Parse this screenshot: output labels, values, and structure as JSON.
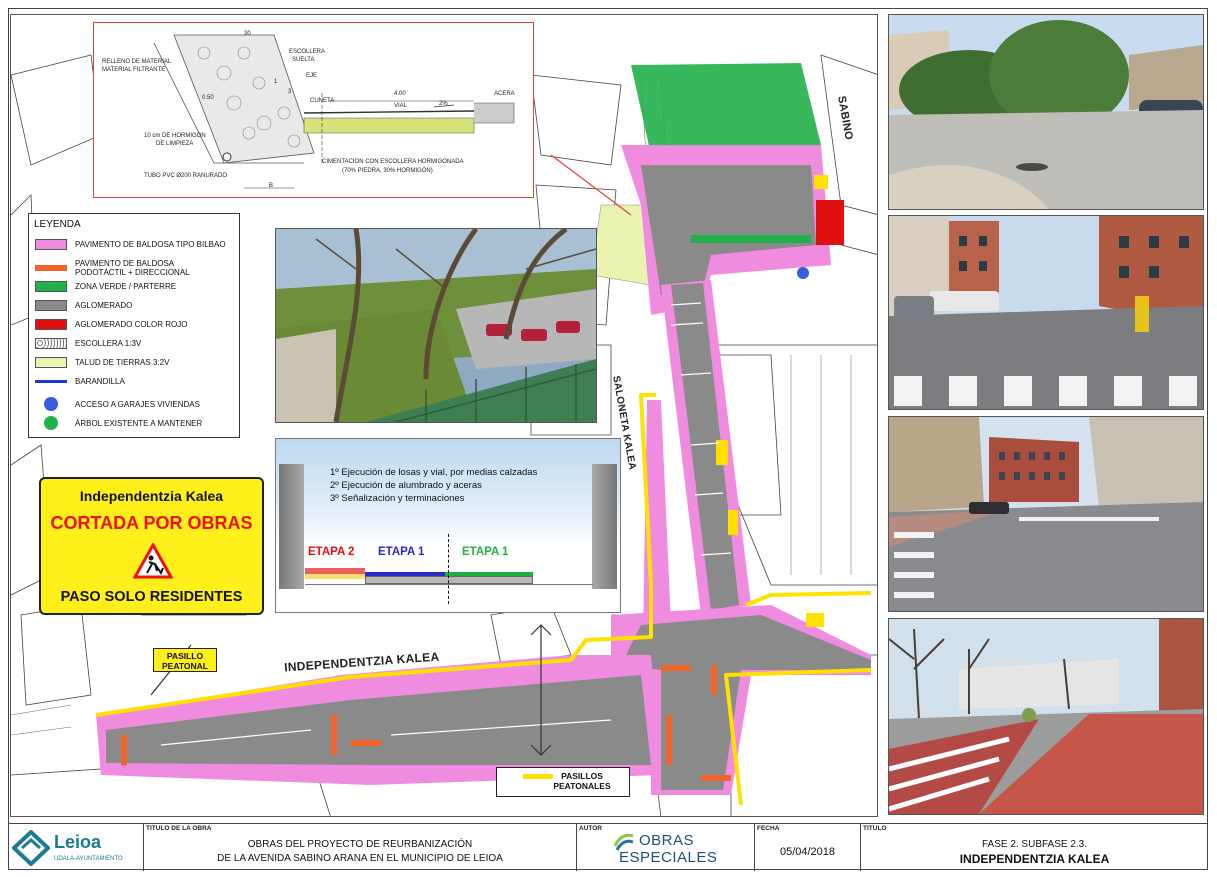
{
  "section": {
    "labels": {
      "relleno": "RELLENO DE MATERIAL",
      "filtrante": "MATERIAL FILTRANTE",
      "escollera": "ESCOLLERA",
      "suelta": "SUELTA",
      "eje": "EJE",
      "cuneta": "CUNETA",
      "vial_dim": "4.00",
      "vial": "VIAL",
      "pendiente": "2%",
      "acera": "ACERA",
      "hormigon": "10 cm DE HORMIGON",
      "limpieza": "DE LIMPIEZA",
      "tubo": "TUBO PVC Ø200 RANURADO",
      "cimentacion": "CIMENTACION CON ESCOLLERA HORMIGONADA",
      "proporcion": "(70% PIEDRA, 30% HORMIGÓN)",
      "talud": "0.50",
      "ratio1": "1",
      "ratio3": "3",
      "b": "B",
      "dim": "30"
    }
  },
  "legend": {
    "title": "LEYENDA",
    "items": [
      {
        "label": "PAVIMENTO DE BALDOSA TIPO BILBAO",
        "color": "#f08ce0"
      },
      {
        "label": "PAVIMENTO DE BALDOSA",
        "label2": "PODOTÁCTIL + DIRECCIONAL",
        "color": "#f0642a"
      },
      {
        "label": "ZONA VERDE / PARTERRE",
        "color": "#22b04a"
      },
      {
        "label": "AGLOMERADO",
        "color": "#8a8a8a"
      },
      {
        "label": "AGLOMERADO COLOR ROJO",
        "color": "#e01010"
      },
      {
        "label": "ESCOLLERA 1:3V",
        "color": "#ffffff"
      },
      {
        "label": "TALUD DE TIERRAS 3:2V",
        "color": "#eaf3b0"
      },
      {
        "label": "BARANDILLA",
        "color": "#1a3ad0"
      },
      {
        "label": "ACCESO A GARAJES VIVIENDAS",
        "color": "#3a5ae0"
      },
      {
        "label": "ÁRBOL EXISTENTE A MANTENER",
        "color": "#22b04a"
      }
    ]
  },
  "stages": {
    "steps": [
      "1º Ejecución de losas y vial, por medias calzadas",
      "2º Ejecución de alumbrado y aceras",
      "3º Señalización y terminaciones"
    ],
    "etapas": [
      {
        "label": "ETAPA 2",
        "color": "#e01010"
      },
      {
        "label": "ETAPA 1",
        "color": "#2a2ac8"
      },
      {
        "label": "ETAPA 1",
        "color": "#20b040"
      }
    ]
  },
  "sign": {
    "line1": "Independentzia Kalea",
    "line2": "CORTADA POR OBRAS",
    "line3": "PASO SOLO RESIDENTES"
  },
  "tags": {
    "pasillo_peatonal": "PASILLO",
    "pasillo_peatonal2": "PEATONAL",
    "pasillos": "PASILLOS",
    "peatonales": "PEATONALES"
  },
  "streets": {
    "independentzia": "INDEPENDENTZIA KALEA",
    "sabino": "SABINO",
    "saloneta": "SALONETA KALEA"
  },
  "title_block": {
    "logo": "Leioa",
    "logo_sub": "UDALA-AYUNTAMIENTO",
    "cap_obra": "TITULO DE LA OBRA",
    "obra_line1": "OBRAS DEL PROYECTO DE REURBANIZACIÓN",
    "obra_line2": "DE LA AVENIDA SABINO ARANA EN EL MUNICIPIO DE LEIOA",
    "cap_autor": "AUTOR",
    "autor1": "OBRAS",
    "autor2": "ESPECIALES",
    "cap_fecha": "FECHA",
    "fecha": "05/04/2018",
    "cap_titulo": "TITULO",
    "titulo1": "FASE 2. SUBFASE 2.3.",
    "titulo2": "INDEPENDENTZIA KALEA"
  }
}
